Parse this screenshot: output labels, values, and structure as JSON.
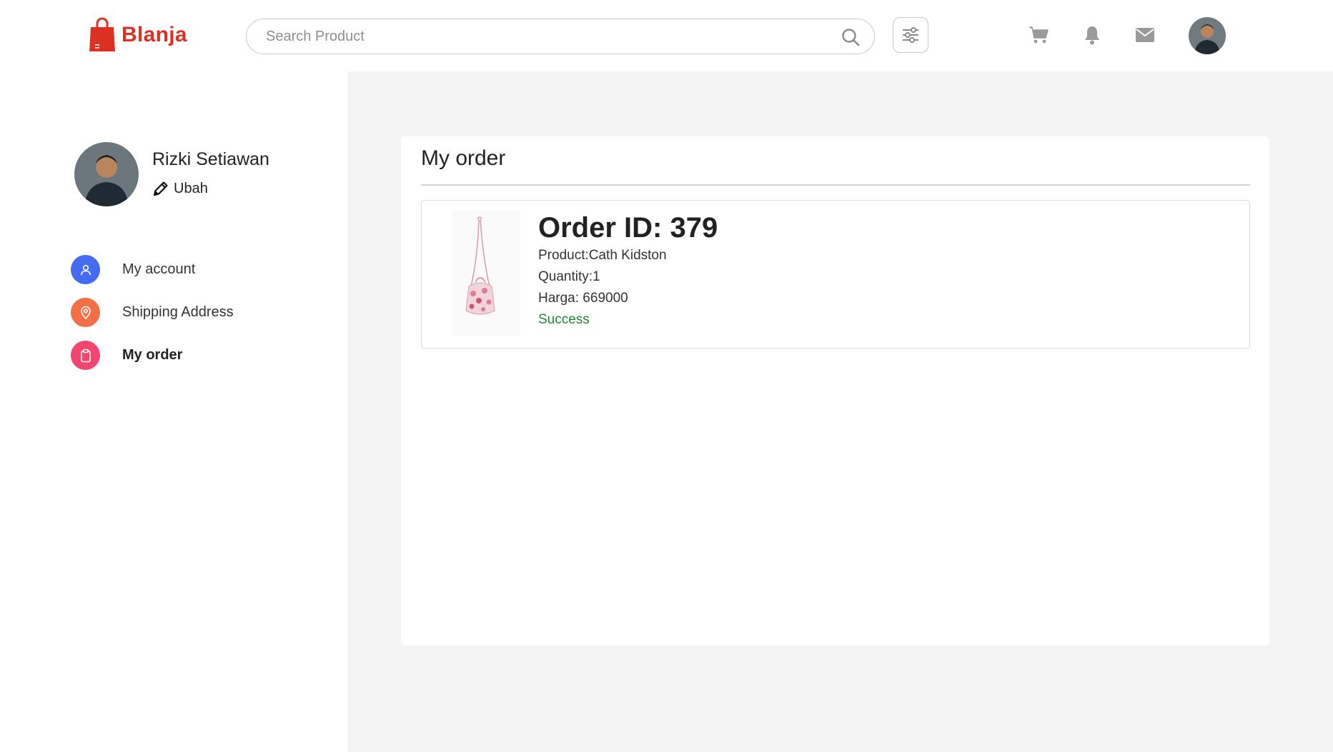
{
  "brand": {
    "name": "Blanja",
    "accent": "#db3022"
  },
  "search": {
    "placeholder": "Search Product"
  },
  "header": {
    "icons": [
      "filter-icon",
      "cart-icon",
      "bell-icon",
      "mail-icon"
    ]
  },
  "profile": {
    "name": "Rizki Setiawan",
    "edit_label": "Ubah"
  },
  "sidebar": {
    "items": [
      {
        "label": "My account",
        "icon": "user-icon",
        "color": "#456bf3"
      },
      {
        "label": "Shipping Address",
        "icon": "location-pin-icon",
        "color": "#f36f45"
      },
      {
        "label": "My order",
        "icon": "clipboard-icon",
        "color": "#f3456f",
        "active": true
      }
    ]
  },
  "main": {
    "title": "My order",
    "orders": [
      {
        "id_label": "Order ID: 379",
        "product": "Product:Cath Kidston",
        "quantity": "Quantity:1",
        "price": "Harga: 669000",
        "status": "Success",
        "status_color": "#1e8a2d"
      }
    ]
  }
}
